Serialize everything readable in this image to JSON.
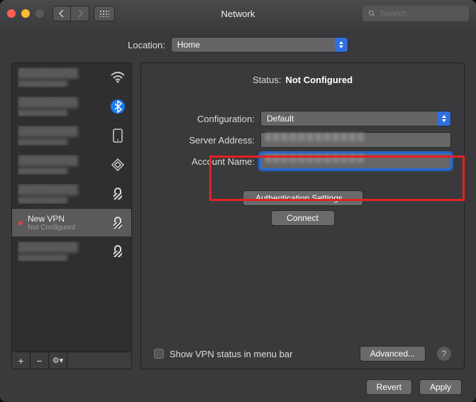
{
  "window": {
    "title": "Network"
  },
  "search": {
    "placeholder": "Search"
  },
  "location": {
    "label": "Location:",
    "value": "Home"
  },
  "sidebar": {
    "items": [
      {
        "icon": "wifi"
      },
      {
        "icon": "bluetooth"
      },
      {
        "icon": "phone"
      },
      {
        "icon": "diamond"
      },
      {
        "icon": "lock"
      },
      {
        "name": "New VPN",
        "sub": "Not Configured",
        "icon": "lock",
        "selected": true
      },
      {
        "icon": "lock"
      }
    ],
    "footer": {
      "add": "+",
      "remove": "−",
      "gear": "⚙︎▾"
    }
  },
  "status": {
    "label": "Status:",
    "value": "Not Configured"
  },
  "config": {
    "label": "Configuration:",
    "value": "Default",
    "server_label": "Server Address:",
    "account_label": "Account Name:"
  },
  "buttons": {
    "auth": "Authentication Settings...",
    "connect": "Connect",
    "advanced": "Advanced...",
    "revert": "Revert",
    "apply": "Apply"
  },
  "checkbox": {
    "label": "Show VPN status in menu bar"
  }
}
